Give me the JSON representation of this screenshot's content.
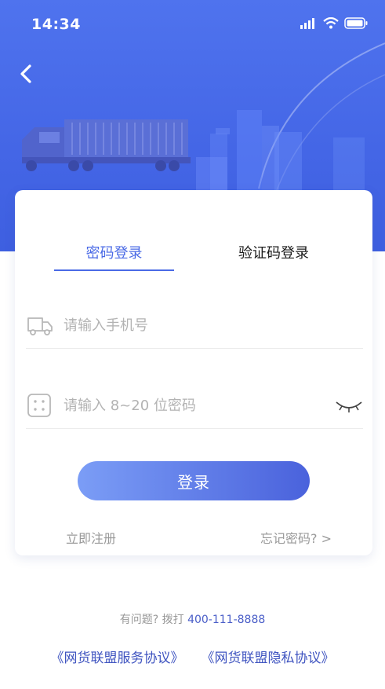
{
  "status_bar": {
    "time": "14:34"
  },
  "login": {
    "tabs": [
      {
        "label": "密码登录",
        "active": true
      },
      {
        "label": "验证码登录",
        "active": false
      }
    ],
    "phone_placeholder": "请输入手机号",
    "password_placeholder": "请输入 8~20 位密码",
    "submit_label": "登录",
    "register_label": "立即注册",
    "forgot_label": "忘记密码? >"
  },
  "footer": {
    "help_prefix": "有问题? 拨打 ",
    "help_phone": "400-111-8888",
    "service_agreement": "《网货联盟服务协议》",
    "privacy_agreement": "《网货联盟隐私协议》"
  },
  "colors": {
    "brand": "#4a6ae6",
    "hero_background": "#4f73ee",
    "link": "#3f54c0"
  },
  "icons": [
    "back-arrow-icon",
    "signal-icon",
    "wifi-icon",
    "battery-icon",
    "truck-icon",
    "keypad-icon",
    "eye-closed-icon"
  ]
}
